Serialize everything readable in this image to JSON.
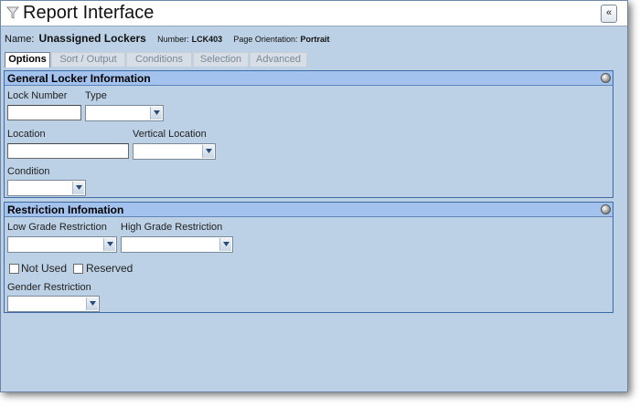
{
  "window": {
    "title": "Report Interface",
    "collapse_label": "«"
  },
  "info": {
    "name_label": "Name:",
    "name_value": "Unassigned Lockers",
    "number_label": "Number:",
    "number_value": "LCK403",
    "orientation_label": "Page Orientation:",
    "orientation_value": "Portrait"
  },
  "tabs": [
    {
      "label": "Options",
      "active": true
    },
    {
      "label": "Sort / Output",
      "active": false
    },
    {
      "label": "Conditions",
      "active": false
    },
    {
      "label": "Selection",
      "active": false
    },
    {
      "label": "Advanced",
      "active": false
    }
  ],
  "general": {
    "header": "General Locker Information",
    "lock_number_label": "Lock Number",
    "lock_number_value": "",
    "type_label": "Type",
    "type_value": "",
    "location_label": "Location",
    "location_value": "",
    "vertical_location_label": "Vertical Location",
    "vertical_location_value": "",
    "condition_label": "Condition",
    "condition_value": ""
  },
  "restriction": {
    "header": "Restriction Infomation",
    "low_grade_label": "Low Grade Restriction",
    "low_grade_value": "",
    "high_grade_label": "High Grade Restriction",
    "high_grade_value": "",
    "not_used_label": "Not Used",
    "not_used_checked": false,
    "reserved_label": "Reserved",
    "reserved_checked": false,
    "gender_label": "Gender Restriction",
    "gender_value": ""
  },
  "colors": {
    "panel_bg": "#bcd1e6",
    "section_header_bg": "#a3c3ee",
    "border": "#3f6aa6"
  }
}
